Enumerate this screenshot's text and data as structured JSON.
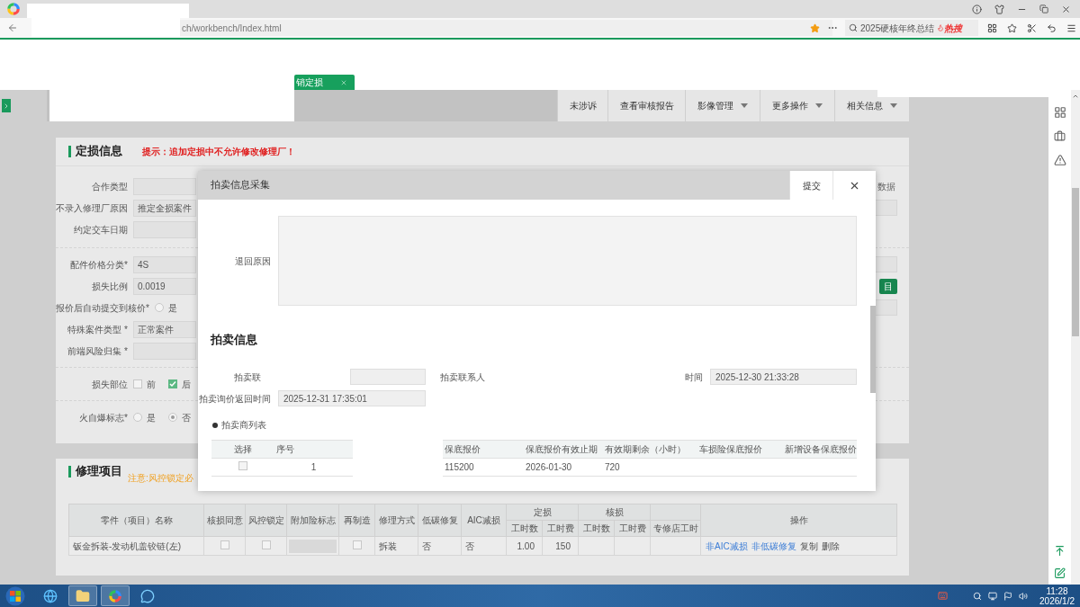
{
  "browser": {
    "url": "ch/workbench/Index.html",
    "search_text": "2025硬核年终总结",
    "search_badge": "热搜",
    "page_tab": "销定损"
  },
  "toolbar": [
    {
      "label": "未涉诉",
      "dropdown": false
    },
    {
      "label": "查看审核报告",
      "dropdown": false
    },
    {
      "label": "影像管理",
      "dropdown": true
    },
    {
      "label": "更多操作",
      "dropdown": true
    },
    {
      "label": "相关信息",
      "dropdown": true
    }
  ],
  "loss_info": {
    "title": "定损信息",
    "hint": "提示：追加定损中不允许修改修理厂！",
    "groups": [
      {
        "fields": [
          {
            "kind": "input",
            "label": "合作类型",
            "right": {
              "kind": "text",
              "label": "数据"
            }
          },
          {
            "kind": "input",
            "label": "不录入修理厂原因",
            "value": "推定全损案件",
            "right": {
              "kind": "input"
            }
          },
          {
            "kind": "input",
            "label": "约定交车日期"
          }
        ]
      },
      {
        "fields": [
          {
            "kind": "input",
            "label": "配件价格分类*",
            "value": "4S",
            "right": {
              "kind": "input"
            }
          },
          {
            "kind": "input",
            "label": "损失比例",
            "value": "0.0019",
            "right": {
              "kind": "button",
              "label": "目"
            }
          },
          {
            "kind": "radio",
            "label": "报价后自动提交到核价*",
            "options": [
              {
                "label": "是",
                "selected": false
              }
            ],
            "right": {
              "kind": "input"
            }
          },
          {
            "kind": "input",
            "label": "特殊案件类型 *",
            "value": "正常案件"
          },
          {
            "kind": "input",
            "label": "前端风险归集 *"
          }
        ]
      },
      {
        "fields": [
          {
            "kind": "checkbox",
            "label": "损失部位",
            "options": [
              {
                "label": "前",
                "checked": false
              },
              {
                "label": "后",
                "checked": true
              }
            ]
          }
        ]
      },
      {
        "fields": [
          {
            "kind": "radio",
            "label": "火自爆标志*",
            "options": [
              {
                "label": "是",
                "selected": false
              },
              {
                "label": "否",
                "selected": true
              }
            ]
          }
        ]
      }
    ]
  },
  "repair": {
    "title": "修理项目",
    "note": "注意:风控锁定必",
    "columns": [
      {
        "label": "零件（项目）名称"
      },
      {
        "label": "核损同意"
      },
      {
        "label": "风控锁定"
      },
      {
        "label": "附加险标志"
      },
      {
        "label": "再制造"
      },
      {
        "label": "修理方式"
      },
      {
        "label": "低碳修复"
      },
      {
        "label": "AIC减损"
      },
      {
        "label": "定损",
        "colspan": 2,
        "children": [
          {
            "label": "工时数"
          },
          {
            "label": "工时费"
          }
        ]
      },
      {
        "label": "核损",
        "colspan": 2,
        "children": [
          {
            "label": "工时数"
          },
          {
            "label": "工时费"
          }
        ]
      },
      {
        "children": [
          {
            "label": "专修店工时"
          }
        ]
      },
      {
        "label": "操作"
      }
    ],
    "rows": [
      {
        "cells": [
          {
            "kind": "text",
            "text": "钣金拆装-发动机盖铰链(左)"
          },
          {
            "kind": "checkbox",
            "checked": false
          },
          {
            "kind": "checkbox",
            "checked": false
          },
          {
            "kind": "field"
          },
          {
            "kind": "checkbox",
            "checked": false
          },
          {
            "kind": "text",
            "text": "拆装"
          },
          {
            "kind": "text",
            "text": "否"
          },
          {
            "kind": "text",
            "text": "否"
          },
          {
            "kind": "number",
            "text": "1.00"
          },
          {
            "kind": "number",
            "text": "150"
          },
          {
            "kind": "empty"
          },
          {
            "kind": "empty"
          },
          {
            "kind": "empty"
          },
          {
            "kind": "links",
            "links": [
              "非AIC减损",
              "非低碳修复",
              "复制",
              "删除"
            ]
          }
        ]
      }
    ]
  },
  "modal": {
    "title": "拍卖信息采集",
    "submit": "提交",
    "reason_label": "退回原因",
    "heading": "拍卖信息",
    "fields": [
      {
        "kind": "input",
        "label": "拍卖联"
      },
      {
        "kind": "label",
        "label": "拍卖联系人"
      },
      {
        "kind": "input",
        "label": "时间",
        "value": "2025-12-30 21:33:28"
      },
      {
        "kind": "input",
        "label": "拍卖询价返回时间",
        "value": "2025-12-31 17:35:01"
      }
    ],
    "list_title": "拍卖商列表",
    "columns": [
      {
        "kind": "text",
        "label": "选择"
      },
      {
        "kind": "text",
        "label": "序号"
      },
      {
        "kind": "hidden"
      },
      {
        "kind": "text",
        "label": "保底报价"
      },
      {
        "kind": "text",
        "label": "保底报价有效止期"
      },
      {
        "kind": "text",
        "label": "有效期剩余（小时）"
      },
      {
        "kind": "text",
        "label": "车损险保底报价"
      },
      {
        "kind": "text",
        "label": "新增设备保底报价"
      }
    ],
    "rows": [
      {
        "cells": [
          {
            "kind": "checkbox",
            "checked": false
          },
          {
            "kind": "text",
            "text": "1"
          },
          {
            "kind": "hidden"
          },
          {
            "kind": "text",
            "text": "115200"
          },
          {
            "kind": "text",
            "text": "2026-01-30"
          },
          {
            "kind": "text",
            "text": "720"
          },
          {
            "kind": "empty"
          },
          {
            "kind": "empty"
          }
        ]
      }
    ]
  },
  "taskbar": {
    "time": "11:28",
    "date": "2026/1/2"
  }
}
